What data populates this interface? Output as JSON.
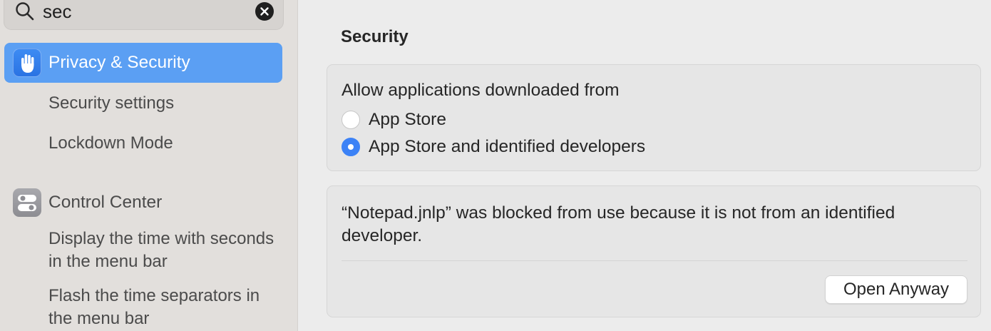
{
  "sidebar": {
    "search": {
      "value": "sec"
    },
    "items": [
      {
        "label": "Privacy & Security",
        "icon": "hand-raised-icon",
        "selected": true
      },
      {
        "label": "Control Center",
        "icon": "toggles-icon",
        "selected": false
      }
    ],
    "privacy_sub": [
      "Security settings",
      "Lockdown Mode"
    ],
    "control_sub": [
      "Display the time with seconds in the menu bar",
      "Flash the time separators in the menu bar"
    ]
  },
  "main": {
    "section_title": "Security",
    "allow_card": {
      "heading": "Allow applications downloaded from",
      "options": [
        {
          "label": "App Store",
          "checked": false
        },
        {
          "label": "App Store and identified developers",
          "checked": true
        }
      ]
    },
    "blocked_card": {
      "message": "“Notepad.jnlp” was blocked from use because it is not from an identified developer.",
      "button": "Open Anyway"
    }
  },
  "colors": {
    "accent": "#3c82f6",
    "selected_row": "#5b9ff3"
  }
}
